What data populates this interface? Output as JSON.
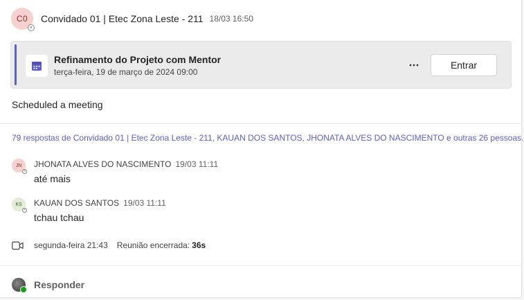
{
  "post": {
    "avatar_initials": "C0",
    "author": "Convidado 01 | Etec Zona Leste - 211",
    "timestamp": "18/03 16:50",
    "body": "Scheduled a meeting"
  },
  "meeting": {
    "icon": "calendar-icon",
    "title": "Refinamento do Projeto com Mentor",
    "date": "terça-feira, 19 de março de 2024 09:00",
    "more_label": "⋯",
    "join_label": "Entrar",
    "accent_color": "#5b5fc7"
  },
  "replies_summary": "79 respostas de Convidado 01 | Etec Zona Leste - 211, KAUAN DOS SANTOS, JHONATA ALVES DO NASCIMENTO e outras 26 pessoas.",
  "replies": [
    {
      "initials": "JN",
      "author": "JHONATA ALVES DO NASCIMENTO",
      "time": "19/03 11:11",
      "text": "até mais",
      "avatar_bg": "#f6d1cf",
      "avatar_fg": "#8a2d2d"
    },
    {
      "initials": "KS",
      "author": "KAUAN DOS SANTOS",
      "time": "19/03 11:11",
      "text": "tchau tchau",
      "avatar_bg": "#e3ecd7",
      "avatar_fg": "#405c26"
    }
  ],
  "meeting_ended": {
    "icon": "video-camera-icon",
    "time": "segunda-feira 21:43",
    "label": "Reunião encerrada:",
    "duration": "36s"
  },
  "reply_bar": {
    "label": "Responder",
    "presence": "available"
  }
}
